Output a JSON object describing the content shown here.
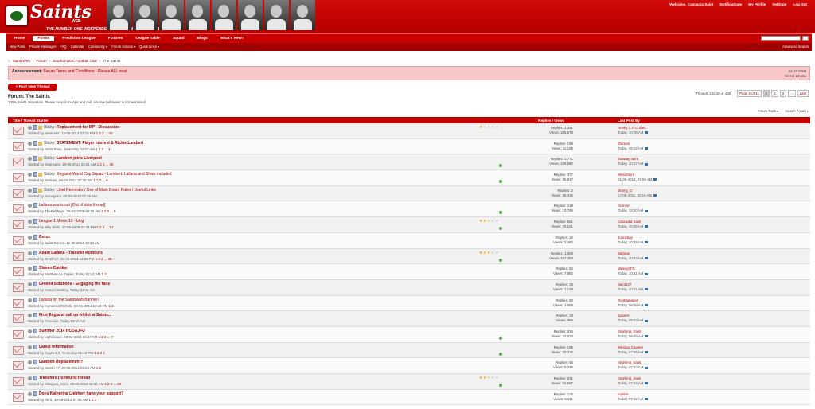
{
  "site": {
    "logo_text": "Saints",
    "logo_sub": "WEB",
    "tagline": "THE NUMBER ONE INDEPENDENT SOUTHAMPTON FC WEBSITE"
  },
  "user_links": [
    "Welcome, Cascadia Saint",
    "Notifications",
    "My Profile",
    "Settings",
    "Log Out"
  ],
  "nav_tabs": [
    "Home",
    "Forum",
    "Prediction League",
    "Fixtures",
    "League Table",
    "Squad",
    "Blogs",
    "What's New?"
  ],
  "active_tab": "Forum",
  "sub_links": [
    "New Posts",
    "Private Messages",
    "FAQ",
    "Calendar",
    "Community ▾",
    "Forum Actions ▾",
    "Quick Links ▾"
  ],
  "advanced_search": "Advanced Search",
  "breadcrumb": [
    "SaintsWeb",
    "Forum",
    "Southampton Football Club",
    "The Saints"
  ],
  "announcement": {
    "label": "Announcement:",
    "text": "Forum Terms and Conditions - Please ALL read",
    "date": "31-07-2008",
    "views": "Views: 23,181"
  },
  "new_thread": "+ Post New Thread",
  "forum": {
    "title": "Forum: The Saints",
    "desc": "100% Saints discussion. Please keep it on-topic and civil. Abusive behaviour is not welcomed."
  },
  "pagination": {
    "info": "Threads 1 to 40 of 435",
    "page_of": "Page 1 of 11",
    "pages": [
      "1",
      "2",
      "3",
      "...",
      "Last"
    ]
  },
  "tools": [
    "Forum Tools ▾",
    "Search Forum ▾"
  ],
  "columns": {
    "title": "Title / Thread Starter",
    "stats": "Replies / Views",
    "last": "Last Post By"
  },
  "threads": [
    {
      "prefix": "Sticky:",
      "title": "Replacement for MP - Discussion",
      "starter": "Started by westsaint, 12-05-2014 02:15 PM",
      "pages": "1 2 3 ... 40",
      "replies": "Replies: 2,291",
      "views": "Views: 185,579",
      "last_user": "Honky CTFC Sant",
      "last_time": "Today, 10:06 AM",
      "stars": 1,
      "sticky": true,
      "dot": false,
      "bold": true
    },
    {
      "prefix": "Sticky:",
      "title": "STATEMENT: Player interest & Rickie Lambert",
      "starter": "Started by Saint Ross, Yesterday 02:07 AM",
      "pages": "1 2 3 ... 4",
      "replies": "Replies: 168",
      "views": "Views: 11,169",
      "last_user": "dfurlock",
      "last_time": "Today, 09:42 AM",
      "stars": 0,
      "sticky": true,
      "dot": false,
      "bold": true
    },
    {
      "prefix": "Sticky:",
      "title": "Lambert joins Liverpool",
      "starter": "Started by IksgrSaint, 29-05-2014 09:21 AM",
      "pages": "1 2 3 ... 36",
      "replies": "Replies: 1,771",
      "views": "Views: 139,580",
      "last_user": "faraway saint",
      "last_time": "Today, 10:17 AM",
      "stars": 0,
      "sticky": true,
      "dot": true,
      "bold": true
    },
    {
      "prefix": "Sticky:",
      "title": "England World Cup Squad - Lambert, Lallana and Shaw included",
      "starter": "Started by Batman, 29-04-2014 07:35 AM",
      "pages": "1 2 3 ... 8",
      "replies": "Replies: 377",
      "views": "Views: 35,817",
      "last_user": "WessSaint",
      "last_time": "01-06-2014, 01:55 AM",
      "stars": 0,
      "sticky": true,
      "dot": true,
      "bold": false
    },
    {
      "prefix": "Sticky:",
      "title": "Libel Reminder / Use of Main Board Rules / Useful Links",
      "starter": "Started by stonegrant, 02-09-2010 07:46 AM",
      "pages": "",
      "replies": "Replies: 2",
      "views": "Views: 35,015",
      "last_user": "Jimmy_D",
      "last_time": "17-09-2011, 02:16 AM",
      "stars": 0,
      "sticky": true,
      "dot": false,
      "bold": false
    },
    {
      "prefix": "",
      "title": "Lallana wants out [Out of date thread]",
      "starter": "Started by TheDelWays, 08-07-2009 09:25 AM",
      "pages": "1 2 3 ... 5",
      "replies": "Replies: 219",
      "views": "Views: 10,766",
      "last_user": "Gemme",
      "last_time": "Today, 10:20 AM",
      "stars": 0,
      "sticky": false,
      "dot": true,
      "bold": false
    },
    {
      "prefix": "",
      "title": "League 1 Minus 10 - blog",
      "starter": "Started by Billy Shits, 17-09-2009 01:38 PM",
      "pages": "1 2 3 ... 14",
      "replies": "Replies: 661",
      "views": "Views: 75,101",
      "last_user": "Cascadia Saint",
      "last_time": "Today, 10:35 AM",
      "stars": 2,
      "sticky": false,
      "dot": true,
      "bold": false
    },
    {
      "prefix": "",
      "title": "Boruc",
      "starter": "Started by Saint Garrett, 11-05-2014 10:43 AM",
      "pages": "",
      "replies": "Replies: 22",
      "views": "Views: 3,482",
      "last_user": "Jonnyboy",
      "last_time": "Today, 10:39 AM",
      "stars": 0,
      "sticky": false,
      "dot": false,
      "bold": true
    },
    {
      "prefix": "",
      "title": "Adam Lallana - Transfer Rumours",
      "starter": "Started by Dr Who?, 08-05-2014 12:53 PM",
      "pages": "1 2 3 ... 38",
      "replies": "Replies: 1,898",
      "views": "Views: 157,393",
      "last_user": "Batman",
      "last_time": "Today, 10:34 AM",
      "stars": 3,
      "sticky": false,
      "dot": true,
      "bold": true
    },
    {
      "prefix": "",
      "title": "Steven Caulker",
      "starter": "Started by Matthew Le Tissier, Today 02:42 AM",
      "pages": "1 2",
      "replies": "Replies: 82",
      "views": "Views: 7,882",
      "last_user": "BlakeySFC",
      "last_time": "Today, 10:31 AM",
      "stars": 0,
      "sticky": false,
      "dot": false,
      "bold": true
    },
    {
      "prefix": "",
      "title": "Green4 Solutions - Engaging the fans",
      "starter": "Started by Convict Colony, Today 02:11 AM",
      "pages": "",
      "replies": "Replies: 19",
      "views": "Views: 1,129",
      "last_user": "Saint137",
      "last_time": "Today, 10:11 AM",
      "stars": 0,
      "sticky": false,
      "dot": false,
      "bold": true
    },
    {
      "prefix": "",
      "title": "Lallana on the Saintsweb Banner?",
      "starter": "Started by mynameisthehulk, 28-01-2014 12:42 PM",
      "pages": "1 2",
      "replies": "Replies: 60",
      "views": "Views: 2,659",
      "last_user": "RonManager",
      "last_time": "Today, 09:58 AM",
      "stars": 0,
      "sticky": false,
      "dot": false,
      "bold": false
    },
    {
      "prefix": "",
      "title": "First England call up whilst at Saints...",
      "starter": "Started by Pancake, Today 03:19 AM",
      "pages": "",
      "replies": "Replies: 18",
      "views": "Views: 895",
      "last_user": "bpsaint",
      "last_time": "Today, 09:53 AM",
      "stars": 0,
      "sticky": false,
      "dot": false,
      "bold": true
    },
    {
      "prefix": "",
      "title": "Summer 2014 HCDAJFU",
      "starter": "Started by Lighthouse, 20-04-2014 04:17 AM",
      "pages": "1 2 3 ... 7",
      "replies": "Replies: 326",
      "views": "Views: 22,973",
      "last_user": "Smirking_Saint",
      "last_time": "Today, 09:09 AM",
      "stars": 0,
      "sticky": false,
      "dot": true,
      "bold": true
    },
    {
      "prefix": "",
      "title": "Latest information",
      "starter": "Started by Guym 2.0, Yesterday 01:12 PM",
      "pages": "1 2 3 4",
      "replies": "Replies: 155",
      "views": "Views: 20,072",
      "last_user": "Window Cleaner",
      "last_time": "Today, 07:56 AM",
      "stars": 0,
      "sticky": false,
      "dot": true,
      "bold": true
    },
    {
      "prefix": "",
      "title": "Lambert Replacement?",
      "starter": "Started by Saint I 77, 30-05-2014 09:54 AM",
      "pages": "1 2",
      "replies": "Replies: 95",
      "views": "Views: 5,345",
      "last_user": "Smirking_Saint",
      "last_time": "Today, 07:53 AM",
      "stars": 0,
      "sticky": false,
      "dot": false,
      "bold": true
    },
    {
      "prefix": "",
      "title": "Transfers (rumours) thread",
      "starter": "Started by Glasgow_Saint, 20-03-2014 11:33 AM",
      "pages": "1 2 3 ... 20",
      "replies": "Replies: 871",
      "views": "Views: 52,567",
      "last_user": "Smirking_Saint",
      "last_time": "Today, 07:52 AM",
      "stars": 2,
      "sticky": false,
      "dot": true,
      "bold": true
    },
    {
      "prefix": "",
      "title": "Does Katherina Liebherr have your support?",
      "starter": "Started by Mr X, 15-05-2014 07:38 AM",
      "pages": "1 2 3",
      "replies": "Replies: 125",
      "views": "Views: 6,011",
      "last_user": "master",
      "last_time": "Today, 07:22 AM",
      "stars": 0,
      "sticky": false,
      "dot": false,
      "bold": true
    }
  ]
}
